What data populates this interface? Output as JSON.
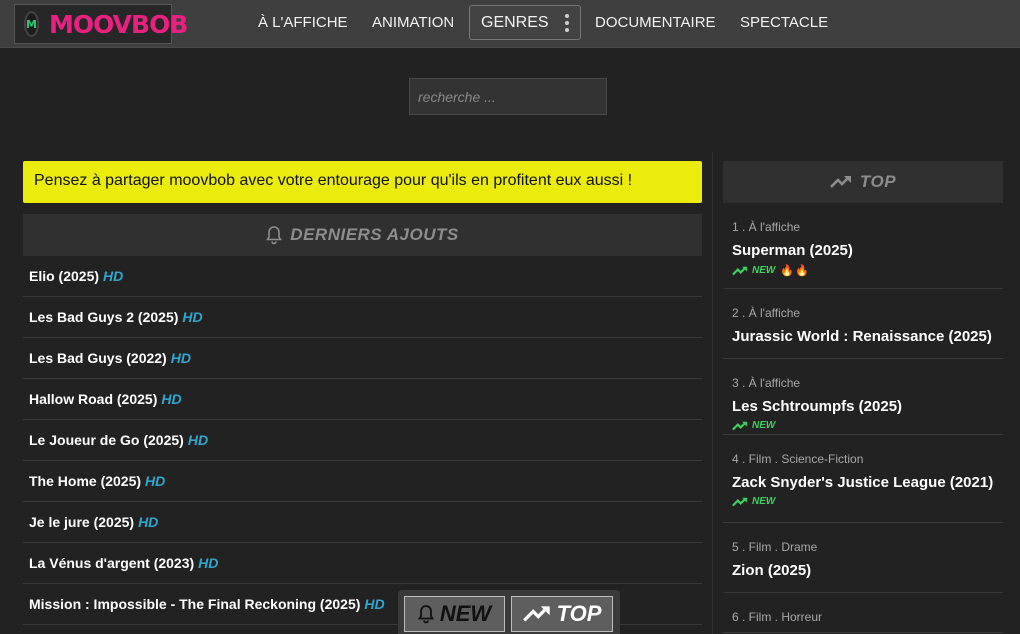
{
  "header": {
    "logo_letter": "M",
    "logo_text": "MOOVBOB",
    "nav": [
      "À L'AFFICHE",
      "ANIMATION",
      "GENRES",
      "DOCUMENTAIRE",
      "SPECTACLE"
    ]
  },
  "search": {
    "placeholder": "recherche ..."
  },
  "banner": {
    "text": "Pensez à partager moovbob avec votre entourage pour qu'ils en profitent eux aussi !"
  },
  "latest": {
    "title": "DERNIERS AJOUTS",
    "hd_label": "HD",
    "items": [
      "Elio (2025)",
      "Les Bad Guys 2 (2025)",
      "Les Bad Guys (2022)",
      "Hallow Road (2025)",
      "Le Joueur de Go (2025)",
      "The Home (2025)",
      "Je le jure (2025)",
      "La Vénus d'argent (2023)",
      "Mission : Impossible - The Final Reckoning (2025)"
    ]
  },
  "top": {
    "title": "TOP",
    "new_label": "NEW",
    "items": [
      {
        "meta": "1 . À l'affiche",
        "title": "Superman (2025)",
        "new": true,
        "fire": "🔥🔥"
      },
      {
        "meta": "2 . À l'affiche",
        "title": "Jurassic World : Renaissance (2025)",
        "new": false
      },
      {
        "meta": "3 . À l'affiche",
        "title": "Les Schtroumpfs (2025)",
        "new": true
      },
      {
        "meta": "4 . Film . Science-Fiction",
        "title": "Zack Snyder's Justice League (2021)",
        "new": true
      },
      {
        "meta": "5 . Film . Drame",
        "title": "Zion (2025)",
        "new": false
      },
      {
        "meta": "6 . Film . Horreur",
        "title": "",
        "new": false
      }
    ]
  },
  "floatbar": {
    "new_label": "NEW",
    "top_label": "TOP"
  },
  "colors": {
    "accent_logo": "#e8207f",
    "banner_bg": "#ebeb0c",
    "hd": "#2fa7cf",
    "new": "#3ecf5e",
    "header_bg": "#3f3f3f",
    "page_bg": "#222222"
  }
}
